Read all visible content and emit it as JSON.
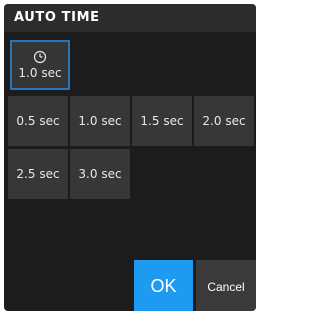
{
  "dialog": {
    "title": "AUTO TIME",
    "current": {
      "icon": "clock-icon",
      "label": "1.0 sec"
    },
    "options": [
      "0.5 sec",
      "1.0 sec",
      "1.5 sec",
      "2.0 sec",
      "2.5 sec",
      "3.0 sec"
    ],
    "ok_label": "OK",
    "cancel_label": "Cancel"
  },
  "colors": {
    "accent": "#1e9bf0",
    "selected_border": "#2b74b8",
    "background": "#1c1c1c",
    "tile": "#373737"
  }
}
